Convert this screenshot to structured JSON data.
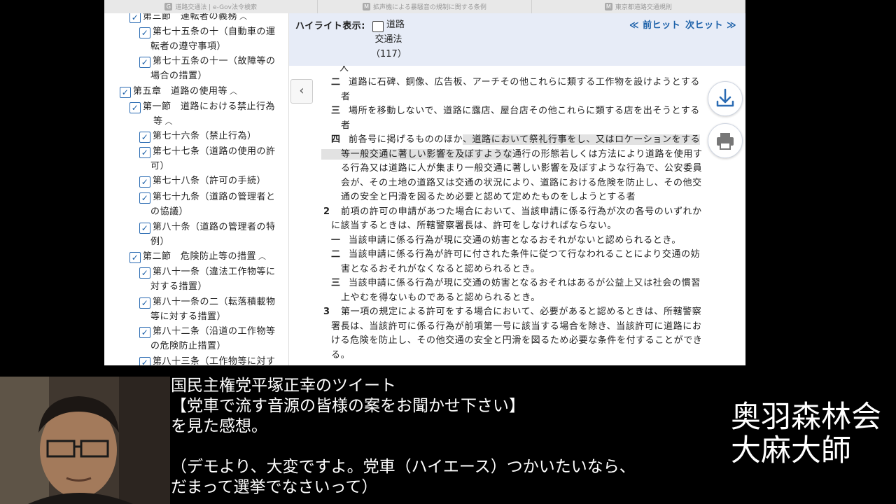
{
  "browser": {
    "tabs": [
      {
        "label": "道路交通法 | e-Gov法令検索",
        "favicon": "G"
      },
      {
        "label": "拡声機による暴騒音の規制に関する条例",
        "favicon": "M"
      },
      {
        "label": "東京都道路交通規則",
        "favicon": "M"
      }
    ]
  },
  "toc": {
    "items": [
      {
        "lines": [
          "第三節　運転者の義務"
        ],
        "caret": true,
        "level": 1
      },
      {
        "lines": [
          "第七十五条の十（自動車の運",
          "転者の遵守事項）"
        ],
        "caret": false,
        "level": 2
      },
      {
        "lines": [
          "第七十五条の十一（故障等の",
          "場合の措置）"
        ],
        "caret": false,
        "level": 2
      },
      {
        "lines": [
          "第五章　道路の使用等"
        ],
        "caret": true,
        "level": 0
      },
      {
        "lines": [
          "第一節　道路における禁止行為",
          "等"
        ],
        "caret": true,
        "level": 1
      },
      {
        "lines": [
          "第七十六条（禁止行為）"
        ],
        "caret": false,
        "level": 2
      },
      {
        "lines": [
          "第七十七条（道路の使用の許",
          "可）"
        ],
        "caret": false,
        "level": 2
      },
      {
        "lines": [
          "第七十八条（許可の手続）"
        ],
        "caret": false,
        "level": 2
      },
      {
        "lines": [
          "第七十九条（道路の管理者と",
          "の協議）"
        ],
        "caret": false,
        "level": 2
      },
      {
        "lines": [
          "第八十条（道路の管理者の特",
          "例）"
        ],
        "caret": false,
        "level": 2
      },
      {
        "lines": [
          "第二節　危険防止等の措置"
        ],
        "caret": true,
        "level": 1
      },
      {
        "lines": [
          "第八十一条（違法工作物等に",
          "対する措置）"
        ],
        "caret": false,
        "level": 2
      },
      {
        "lines": [
          "第八十一条の二（転落積載物",
          "等に対する措置）"
        ],
        "caret": false,
        "level": 2
      },
      {
        "lines": [
          "第八十二条（沿道の工作物等",
          "の危険防止措置）"
        ],
        "caret": false,
        "level": 2
      },
      {
        "lines": [
          "第八十三条（工作物等に対す"
        ],
        "caret": false,
        "level": 2
      }
    ]
  },
  "highlight": {
    "label": "ハイライト表示:",
    "term_lines": [
      "道路",
      "交通法",
      "（117）"
    ],
    "prev": "≪ 前ヒット",
    "next": "次ヒット ≫"
  },
  "law": {
    "lines": [
      {
        "marker": "",
        "text": "人",
        "hl": ""
      },
      {
        "marker": "二",
        "text": "道路に石碑、銅像、広告板、アーチその他これらに類する工作物を設けようとする",
        "hl": ""
      },
      {
        "marker": "",
        "text": "者",
        "hl": ""
      },
      {
        "marker": "三",
        "text": "場所を移動しないで、道路に露店、屋台店その他これらに類する店を出そうとする",
        "hl": ""
      },
      {
        "marker": "",
        "text": "者",
        "hl": ""
      },
      {
        "marker": "四",
        "text": "前各号に掲げるもののほか",
        "hl": "、道路において祭礼行事をし、又はロケーションをする"
      },
      {
        "marker": "",
        "text": "",
        "hl": "等一般交通に著しい影響を及ぼすような",
        "after": "通行の形態若しくは方法により道路を使用す"
      },
      {
        "marker": "",
        "text": "る行為又は道路に人が集まり一般交通に著しい影響を及ぼすような行為で、公安委員",
        "hl": ""
      },
      {
        "marker": "",
        "text": "会が、その土地の道路又は交通の状況により、道路における危険を防止し、その他交",
        "hl": ""
      },
      {
        "marker": "",
        "text": "通の安全と円滑を図るため必要と認めて定めたものをしようとする者",
        "hl": ""
      },
      {
        "marker": "2",
        "text": "前項の許可の申請があつた場合において、当該申請に係る行為が次の各号のいずれか",
        "hl": ""
      },
      {
        "marker": "",
        "text": "に該当するときは、所轄警察署長は、許可をしなければならない。",
        "hl": ""
      },
      {
        "marker": "一",
        "text": "当該申請に係る行為が現に交通の妨害となるおそれがないと認められるとき。",
        "hl": ""
      },
      {
        "marker": "二",
        "text": "当該申請に係る行為が許可に付された条件に従つて行なわれることにより交通の妨",
        "hl": ""
      },
      {
        "marker": "",
        "text": "害となるおそれがなくなると認められるとき。",
        "hl": ""
      },
      {
        "marker": "三",
        "text": "当該申請に係る行為が現に交通の妨害となるおそれはあるが公益上又は社会の慣習",
        "hl": ""
      },
      {
        "marker": "",
        "text": "上やむを得ないものであると認められるとき。",
        "hl": ""
      },
      {
        "marker": "3",
        "text": "第一項の規定による許可をする場合において、必要があると認めるときは、所轄警察",
        "hl": ""
      },
      {
        "marker": "",
        "text": "署長は、当該許可に係る行為が前項第一号に該当する場合を除き、当該許可に道路にお",
        "hl": ""
      },
      {
        "marker": "",
        "text": "ける危険を防止し、その他交通の安全と円滑を図るため必要な条件を付することができ",
        "hl": ""
      },
      {
        "marker": "",
        "text": "る。",
        "hl": ""
      }
    ]
  },
  "caption": {
    "lines": [
      "国民主権党平塚正幸のツイート",
      "【党車で流す音源の皆様の案をお聞かせ下さい】",
      "を見た感想。",
      "",
      "（デモより、大変ですよ。党車（ハイエース）つかいたいなら、",
      "だまって選挙でなさいって）"
    ]
  },
  "brand": {
    "lines": [
      "奥羽森林会",
      "大麻大師"
    ]
  }
}
